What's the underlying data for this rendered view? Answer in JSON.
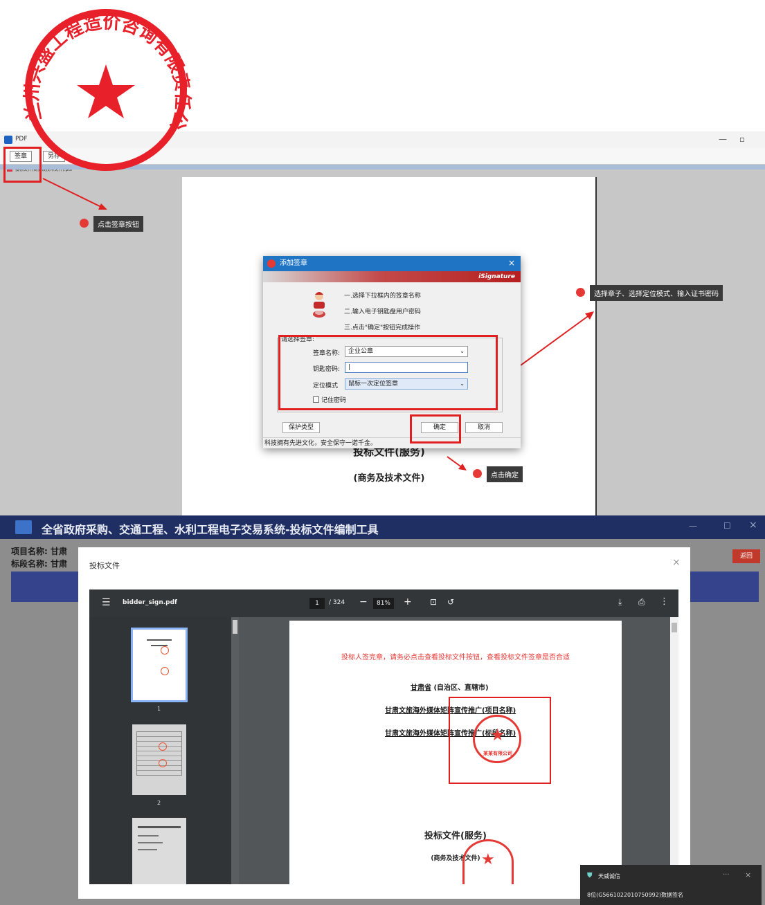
{
  "top_window": {
    "title": "PDF",
    "toolbar_sign_label": "签章",
    "toolbar_second_label": "另存",
    "doc_tab_label": "投标文件(商务及技术文件).pdf"
  },
  "callouts": [
    {
      "num": "1",
      "label": "点击签章按钮"
    },
    {
      "num": "2",
      "label": "选择章子、选择定位模式、输入证书密码"
    },
    {
      "num": "3",
      "label": "点击确定"
    }
  ],
  "dialog": {
    "title": "添加签章",
    "brand": "iSignature",
    "steps": [
      "一.选择下拉框内的签章名称",
      "二.输入电子钥匙盘用户密码",
      "三.点击\"确定\"按钮完成操作"
    ],
    "group_label": "请选择签章:",
    "fields": {
      "name_label": "签章名称:",
      "name_value": "企业公章",
      "password_label": "钥匙密码:",
      "password_value": "",
      "mode_label": "定位模式",
      "mode_value": "鼠标一次定位签章",
      "remember_label": "记住密码"
    },
    "protect_button": "保护类型",
    "ok_button": "确定",
    "cancel_button": "取消",
    "status": "科技拥有先进文化，安全保守一诺千金。"
  },
  "top_doc": {
    "heading": "投标文件(服务)",
    "subheading": "(商务及技术文件)"
  },
  "bottom_app": {
    "title": "全省政府采购、交通工程、水利工程电子交易系统-投标文件编制工具",
    "project_label": "项目名称:",
    "project_value": "甘肃",
    "section_label": "标段名称:",
    "section_value": "甘肃",
    "right_button": "返回"
  },
  "modal": {
    "title": "投标文件",
    "close": "×"
  },
  "viewer": {
    "filename": "bidder_sign.pdf",
    "page_current": "1",
    "page_total": "/ 324",
    "zoom": "81%",
    "thumb_labels": [
      "1",
      "2"
    ]
  },
  "pdf_page": {
    "warning": "投标人签完章，请务必点击查看投标文件按钮，查看投标文件签章是否合适",
    "line1_a": "甘肃省",
    "line1_b": "(自治区、直辖市)",
    "line2": "甘肃文旅海外媒体矩阵宣传推广(项目名称)",
    "line3": "甘肃文旅海外媒体矩阵宣传推广(标段名称)",
    "title": "投标文件(服务)",
    "subtitle": "(商务及技术文件)",
    "seal_text": "某某有限公司"
  },
  "toast": {
    "app": "天威诚信",
    "message": "8位(G5661022010750992)数据签名"
  },
  "seal": {
    "text": "兰州兴盛工程造价咨询有限责任公司",
    "color": "#e8202a"
  },
  "colors": {
    "accent_red": "#e02020",
    "header_navy": "#1f2f63",
    "dialog_title_blue": "#1f74c4"
  }
}
